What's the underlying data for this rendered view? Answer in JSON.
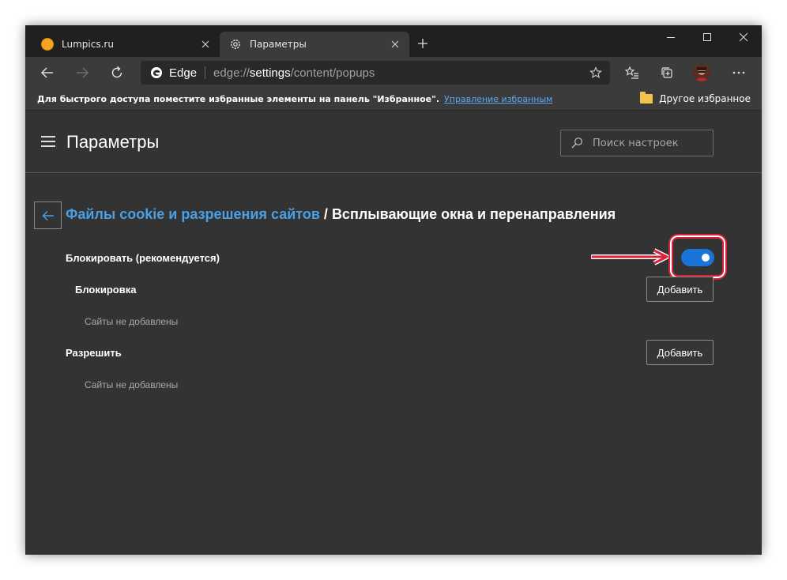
{
  "tabs": [
    {
      "title": "Lumpics.ru",
      "active": false
    },
    {
      "title": "Параметры",
      "active": true
    }
  ],
  "address_bar": {
    "brand": "Edge",
    "url_scheme": "edge://",
    "url_host": "settings",
    "url_path": "/content/popups"
  },
  "favorites_bar": {
    "hint": "Для быстрого доступа поместите избранные элементы на панель \"Избранное\".",
    "manage_link": "Управление избранным",
    "other_favorites": "Другое избранное"
  },
  "settings": {
    "title": "Параметры",
    "search_placeholder": "Поиск настроек"
  },
  "breadcrumb": {
    "parent": "Файлы cookie и разрешения сайтов",
    "separator": " / ",
    "current": "Всплывающие окна и перенаправления"
  },
  "block_setting": {
    "label": "Блокировать (рекомендуется)",
    "enabled": true
  },
  "block_section": {
    "title": "Блокировка",
    "add_label": "Добавить",
    "empty_text": "Сайты не добавлены"
  },
  "allow_section": {
    "title": "Разрешить",
    "add_label": "Добавить",
    "empty_text": "Сайты не добавлены"
  },
  "colors": {
    "accent": "#1a73d6",
    "link": "#4aa0e6",
    "annotation": "#d9233a",
    "background": "#333333"
  }
}
